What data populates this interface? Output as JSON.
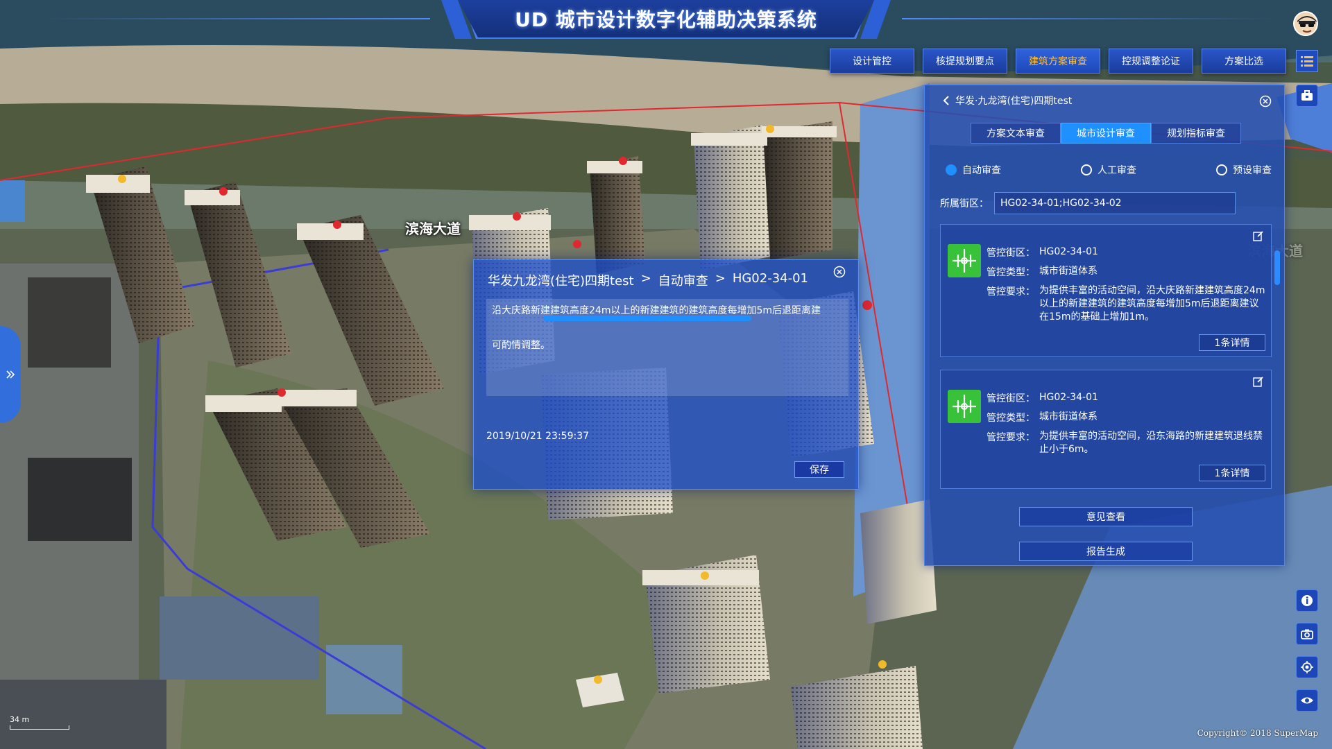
{
  "app": {
    "title": "UD 城市设计数字化辅助决策系统"
  },
  "topnav": {
    "items": [
      {
        "label": "设计管控",
        "active": false
      },
      {
        "label": "核提规划要点",
        "active": false
      },
      {
        "label": "建筑方案审查",
        "active": true
      },
      {
        "label": "控规调整论证",
        "active": false
      },
      {
        "label": "方案比选",
        "active": false
      }
    ]
  },
  "map": {
    "road_label_1": "滨海大道",
    "road_label_2": "滨海大道",
    "scale_text": "34 m",
    "copyright": "Copyright© 2018 SuperMap"
  },
  "panel": {
    "project_title": "华发·九龙湾(住宅)四期test",
    "tabs": [
      {
        "label": "方案文本审查",
        "active": false
      },
      {
        "label": "城市设计审查",
        "active": true
      },
      {
        "label": "规划指标审查",
        "active": false
      }
    ],
    "radios": [
      {
        "label": "自动审查",
        "checked": true
      },
      {
        "label": "人工审查",
        "checked": false
      },
      {
        "label": "预设审查",
        "checked": false
      }
    ],
    "district_label": "所属街区：",
    "district_value": "HG02-34-01;HG02-34-02",
    "cards": [
      {
        "district_key": "管控街区：",
        "district_val": "HG02-34-01",
        "type_key": "管控类型：",
        "type_val": "城市街道体系",
        "req_key": "管控要求：",
        "req_val": "为提供丰富的活动空间，沿大庆路新建建筑高度24m以上的新建建筑的建筑高度每增加5m后退距离建议在15m的基础上增加1m。",
        "more": "1条详情"
      },
      {
        "district_key": "管控街区：",
        "district_val": "HG02-34-01",
        "type_key": "管控类型：",
        "type_val": "城市街道体系",
        "req_key": "管控要求：",
        "req_val": "为提供丰富的活动空间，沿东海路的新建建筑退线禁止小于6m。",
        "more": "1条详情"
      }
    ],
    "btn_opinion": "意见查看",
    "btn_report": "报告生成"
  },
  "popup": {
    "crumb_project": "华发九龙湾(住宅)四期test",
    "crumb_sep": ">",
    "crumb_mode": "自动审查",
    "crumb_district": "HG02-34-01",
    "text_line1": "沿大庆路新建建筑高度24m以上的新建建筑的建筑高度每增加5m后退距离建",
    "text_line2": "可酌情调整。",
    "timestamp": "2019/10/21 23:59:37",
    "save_label": "保存"
  },
  "colors": {
    "accent": "#1e90ff",
    "active_nav_text": "#ffc13a",
    "panel_bg": "#244eb2",
    "icon_green": "#37c23a"
  }
}
